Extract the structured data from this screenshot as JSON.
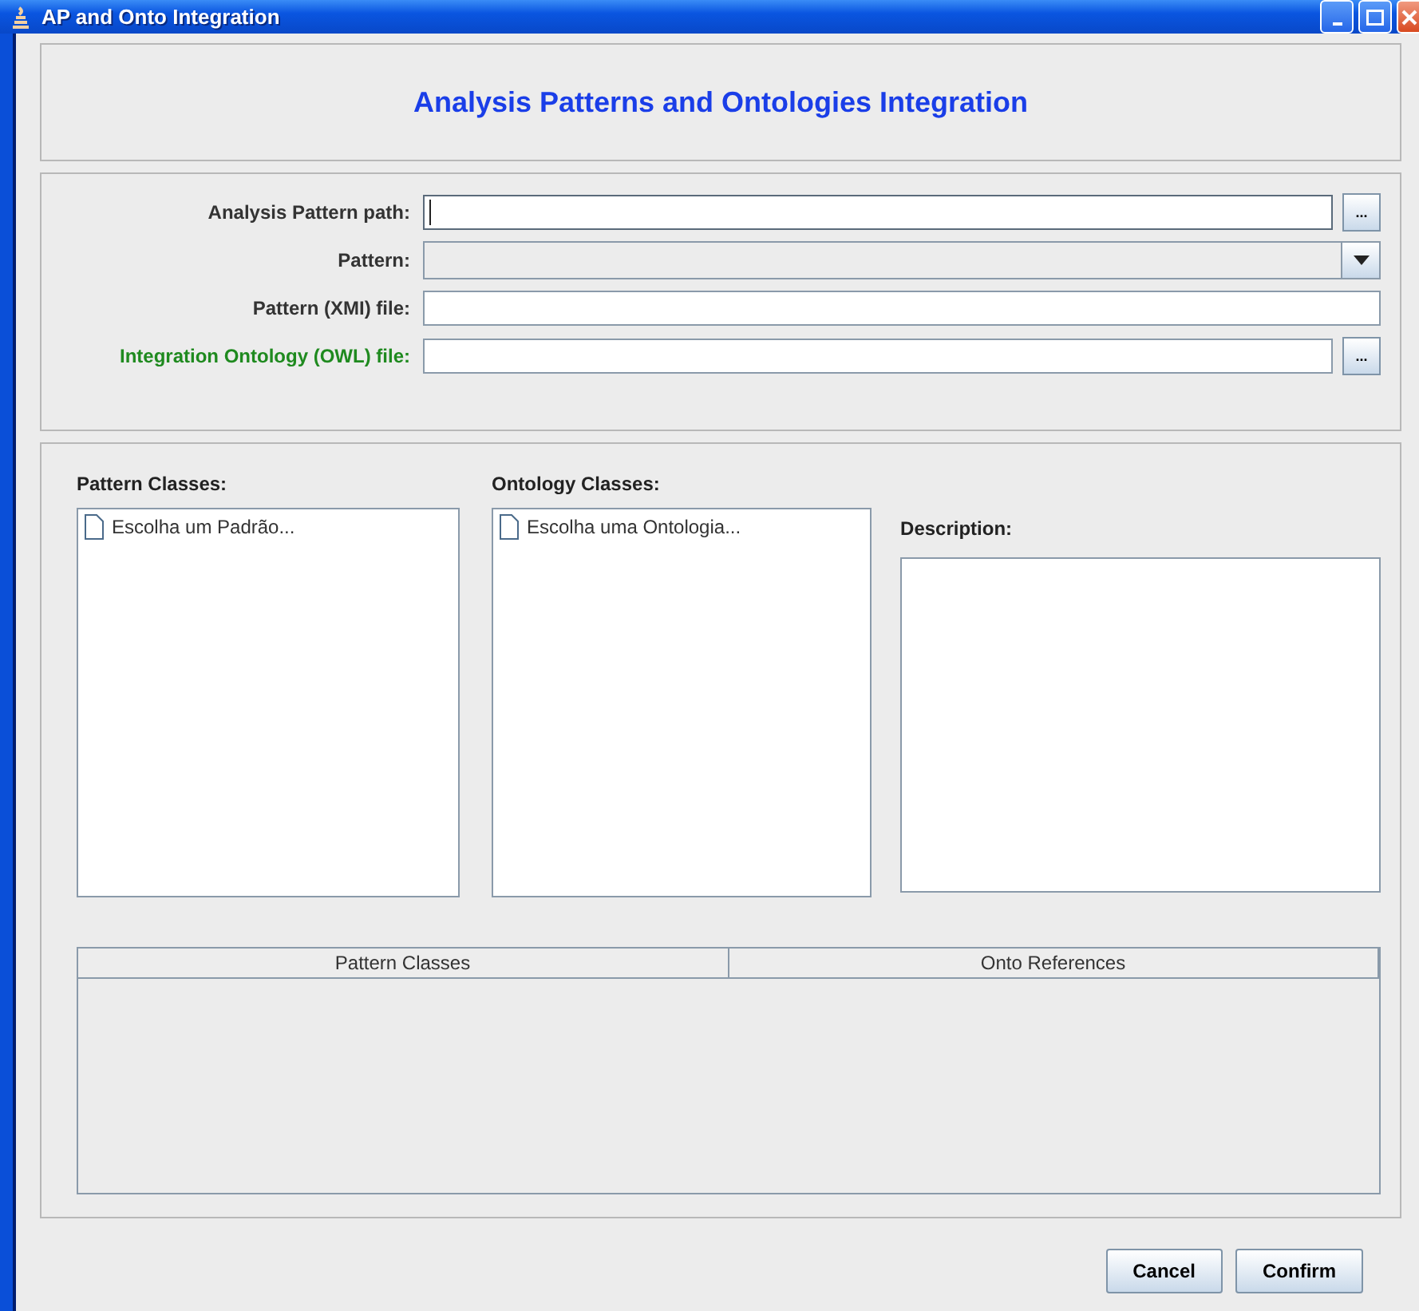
{
  "window": {
    "title": "AP and Onto Integration"
  },
  "header": {
    "title": "Analysis Patterns and Ontologies Integration"
  },
  "form": [
    {
      "label": "Analysis Pattern path:",
      "kind": "text",
      "browse": "...",
      "focused": true,
      "color": "#333333"
    },
    {
      "label": "Pattern:",
      "kind": "combo",
      "disabled": true,
      "color": "#333333"
    },
    {
      "label": "Pattern (XMI) file:",
      "kind": "text",
      "focused": false,
      "color": "#333333"
    },
    {
      "label": "Integration Ontology (OWL) file:",
      "kind": "text",
      "browse": "...",
      "focused": false,
      "color": "#1f8a1f"
    }
  ],
  "pattern_classes": {
    "label": "Pattern Classes:",
    "items": [
      {
        "text": "Escolha um Padrão..."
      }
    ]
  },
  "ontology_classes": {
    "label": "Ontology Classes:",
    "items": [
      {
        "text": "Escolha uma Ontologia..."
      }
    ]
  },
  "description": {
    "label": "Description:"
  },
  "table": {
    "columns": [
      "Pattern Classes",
      "Onto References"
    ]
  },
  "buttons": [
    "Cancel",
    "Confirm"
  ]
}
